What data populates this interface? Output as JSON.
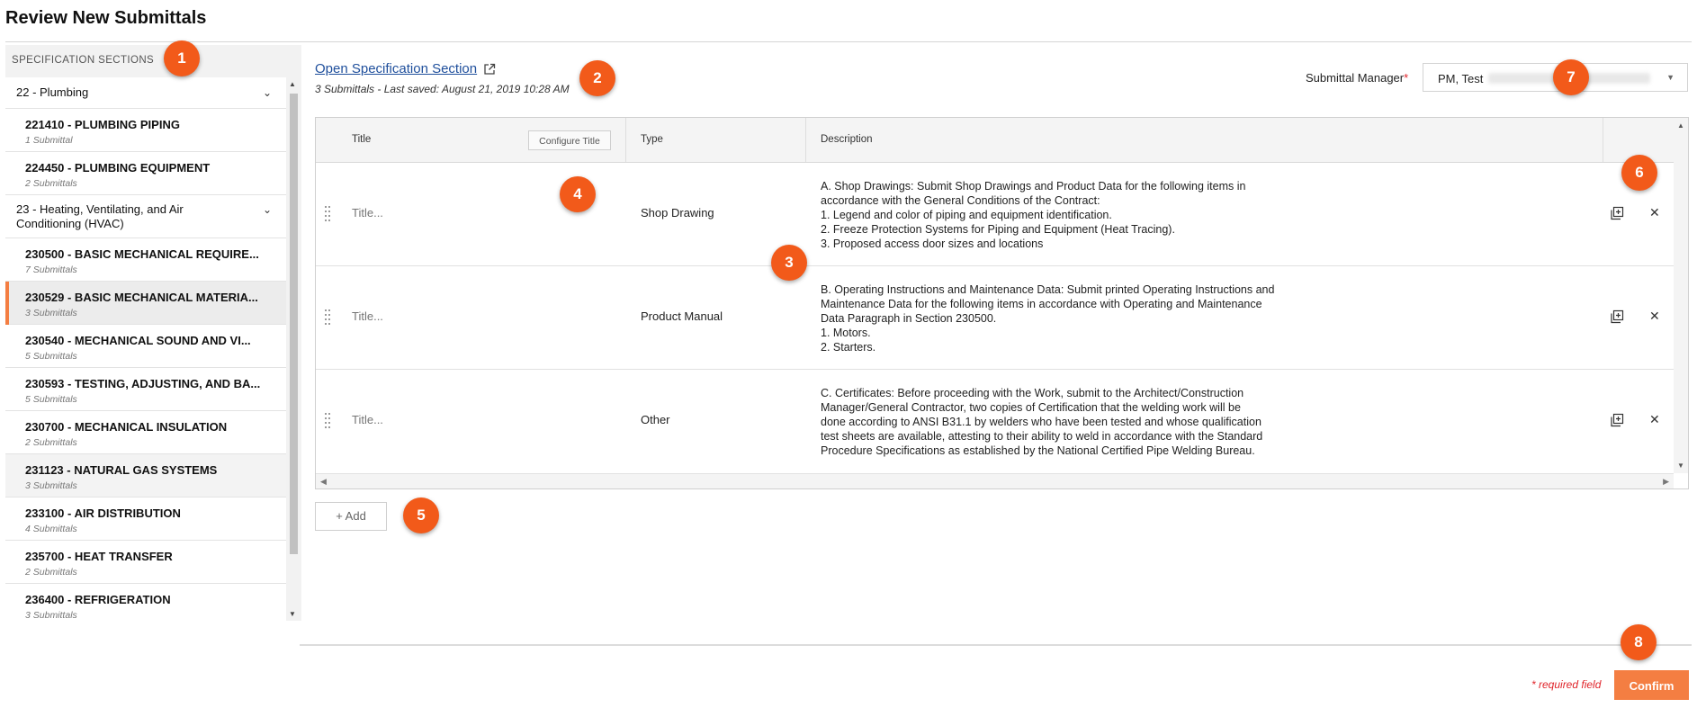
{
  "page": {
    "title": "Review New Submittals"
  },
  "sidebar": {
    "header": "SPECIFICATION SECTIONS",
    "groups": [
      {
        "label": "22 - Plumbing"
      },
      {
        "label": "23 - Heating, Ventilating, and Air Conditioning (HVAC)"
      }
    ],
    "items": [
      {
        "label": "221410 - PLUMBING PIPING",
        "count": "1 Submittal"
      },
      {
        "label": "224450 - PLUMBING EQUIPMENT",
        "count": "2 Submittals"
      },
      {
        "label": "230500 - BASIC MECHANICAL REQUIRE...",
        "count": "7 Submittals"
      },
      {
        "label": "230529 - BASIC MECHANICAL MATERIA...",
        "count": "3 Submittals"
      },
      {
        "label": "230540 - MECHANICAL SOUND AND VI...",
        "count": "5 Submittals"
      },
      {
        "label": "230593 - TESTING, ADJUSTING, AND BA...",
        "count": "5 Submittals"
      },
      {
        "label": "230700 - MECHANICAL INSULATION",
        "count": "2 Submittals"
      },
      {
        "label": "231123 - NATURAL GAS SYSTEMS",
        "count": "3 Submittals"
      },
      {
        "label": "233100 - AIR DISTRIBUTION",
        "count": "4 Submittals"
      },
      {
        "label": "235700 - HEAT TRANSFER",
        "count": "2 Submittals"
      },
      {
        "label": "236400 - REFRIGERATION",
        "count": "3 Submittals"
      }
    ]
  },
  "content": {
    "open_spec_link": "Open Specification Section",
    "saved_text": "3 Submittals - Last saved: August 21, 2019 10:28 AM",
    "manager_label": "Submittal Manager",
    "manager_required": "*",
    "manager_value": "PM, Test"
  },
  "table": {
    "headers": {
      "title": "Title",
      "configure": "Configure Title",
      "type": "Type",
      "description": "Description"
    },
    "title_placeholder": "Title...",
    "rows": [
      {
        "type": "Shop Drawing",
        "description": "A. Shop Drawings: Submit Shop Drawings and Product Data for the following items in\naccordance with the General Conditions of the Contract:\n1. Legend and color of piping and equipment identification.\n2. Freeze Protection Systems for Piping and Equipment (Heat Tracing).\n3. Proposed access door sizes and locations"
      },
      {
        "type": "Product Manual",
        "description": "B. Operating Instructions and Maintenance Data: Submit printed Operating Instructions and\nMaintenance Data for the following items in accordance with Operating and Maintenance\nData Paragraph in Section 230500.\n1. Motors.\n2. Starters."
      },
      {
        "type": "Other",
        "description": "C. Certificates: Before proceeding with the Work, submit to the Architect/Construction\nManager/General Contractor, two copies of Certification that the welding work will be\ndone according to ANSI B31.1 by welders who have been tested and whose qualification\ntest sheets are available, attesting to their ability to weld in accordance with the Standard\nProcedure Specifications as established by the National Certified Pipe Welding Bureau."
      }
    ]
  },
  "actions": {
    "add_label": "+ Add",
    "required_note": "* required field",
    "confirm_label": "Confirm"
  },
  "callouts": [
    "1",
    "2",
    "3",
    "4",
    "5",
    "6",
    "7",
    "8"
  ],
  "icons": {
    "chevron": "chevron-down-icon",
    "external": "external-link-icon",
    "duplicate": "duplicate-icon",
    "delete": "close-icon",
    "drag": "drag-handle-icon"
  },
  "colors": {
    "accent": "#f47e42",
    "callout": "#f25a1a",
    "link": "#1f4f9c",
    "required": "#e0242a"
  }
}
